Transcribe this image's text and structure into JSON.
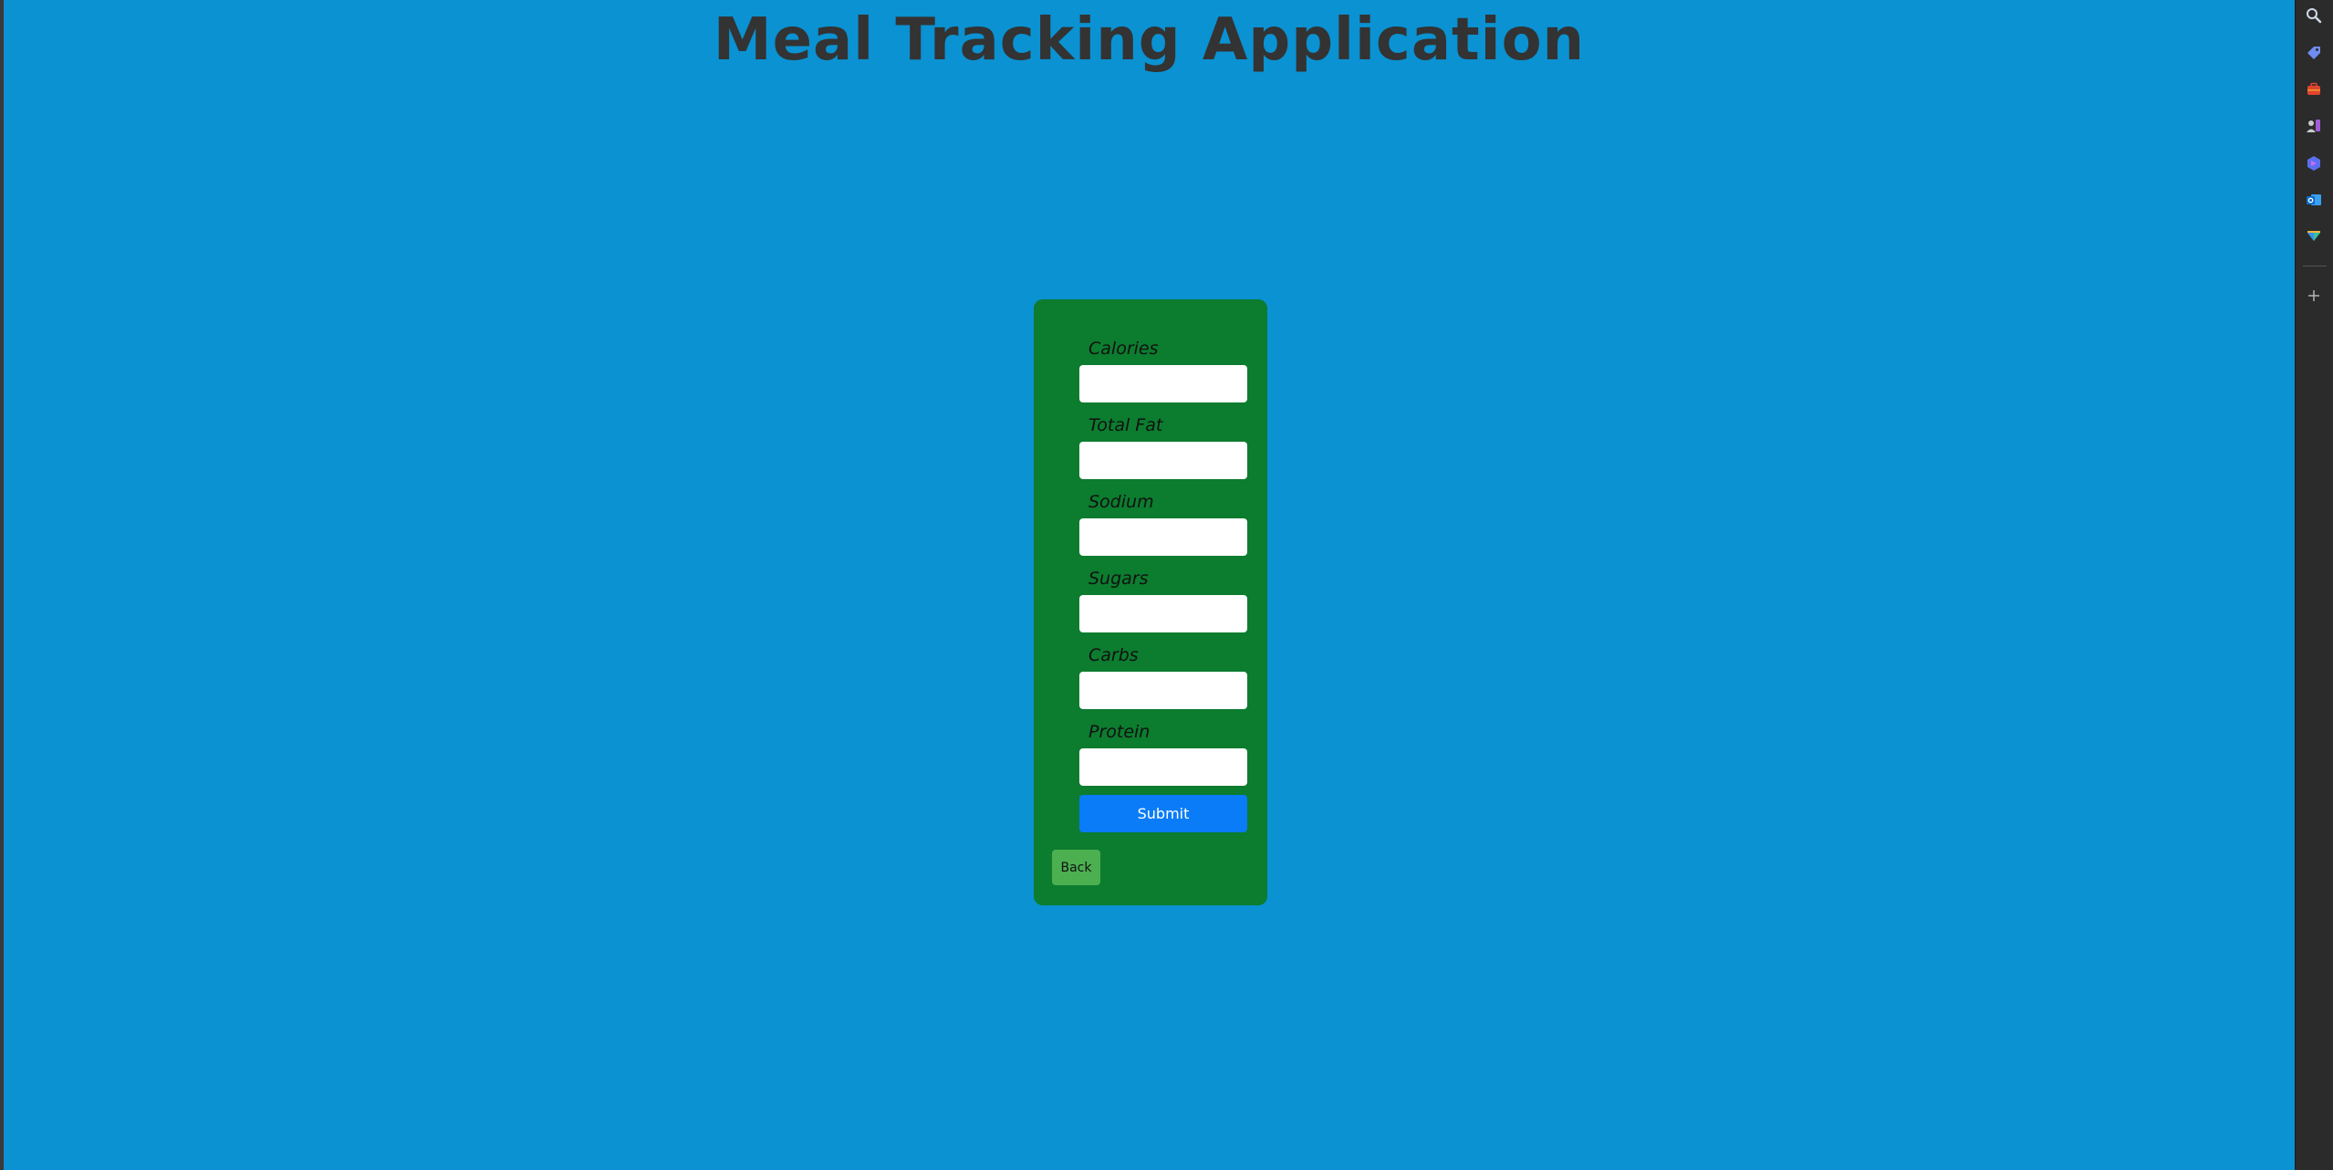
{
  "page": {
    "title": "Meal Tracking Application"
  },
  "form": {
    "fields": [
      {
        "label": "Calories",
        "value": "",
        "placeholder": ""
      },
      {
        "label": "Total Fat",
        "value": "",
        "placeholder": ""
      },
      {
        "label": "Sodium",
        "value": "",
        "placeholder": ""
      },
      {
        "label": "Sugars",
        "value": "",
        "placeholder": ""
      },
      {
        "label": "Carbs",
        "value": "",
        "placeholder": ""
      },
      {
        "label": "Protein",
        "value": "",
        "placeholder": ""
      }
    ],
    "submit_label": "Submit",
    "back_label": "Back"
  },
  "sidebar": {
    "icons": [
      "search-icon",
      "tag-icon",
      "briefcase-icon",
      "people-icon",
      "copilot-icon",
      "outlook-icon",
      "drop-icon",
      "add-icon"
    ]
  },
  "colors": {
    "page_background": "#0a92d2",
    "card_background": "#0c7c2f",
    "submit_button": "#0a7cf7",
    "back_button": "#4caf50",
    "title_text": "#333333"
  }
}
